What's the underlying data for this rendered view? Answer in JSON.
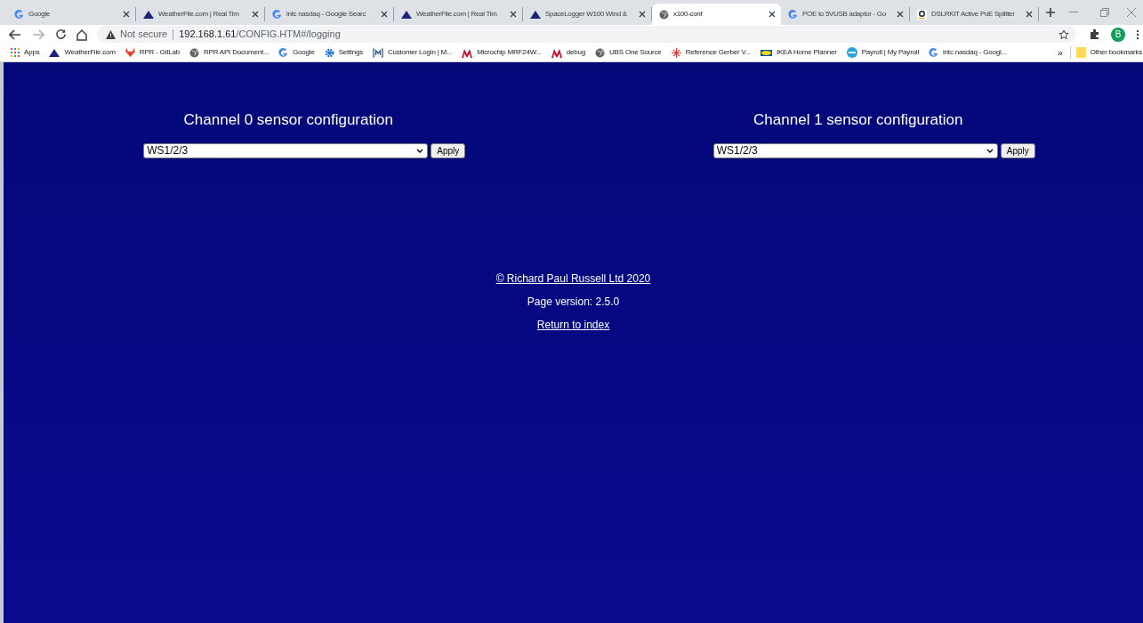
{
  "tabs": [
    {
      "title": "Google",
      "kind": "google",
      "selected": false
    },
    {
      "title": "WeatherFile.com | Real Tim",
      "kind": "triangle",
      "selected": false
    },
    {
      "title": "intc nasdaq - Google Searc",
      "kind": "google",
      "selected": false
    },
    {
      "title": "WeatherFile.com | Real Tim",
      "kind": "triangle",
      "selected": false
    },
    {
      "title": "SpaceLogger W100 Wind &",
      "kind": "triangle",
      "selected": false
    },
    {
      "title": "x100-conf",
      "kind": "globe",
      "selected": true
    },
    {
      "title": "POE to 5VUSB adaptor - Go",
      "kind": "google",
      "selected": false
    },
    {
      "title": "DSLRKIT Active PoE Splitter",
      "kind": "amazon",
      "selected": false
    }
  ],
  "address_bar": {
    "security": "Not secure",
    "host": "192.168.1.61",
    "path": "/CONFIG.HTM#/logging"
  },
  "profile": "B",
  "bookmarks": [
    {
      "label": "Apps",
      "kind": "apps"
    },
    {
      "label": "WeatherFile.com",
      "kind": "triangle"
    },
    {
      "label": "RPR - GitLab",
      "kind": "gitlab"
    },
    {
      "label": "RPR API Document...",
      "kind": "globe"
    },
    {
      "label": "Google",
      "kind": "google"
    },
    {
      "label": "Settings",
      "kind": "gear"
    },
    {
      "label": "Customer Login | M...",
      "kind": "m"
    },
    {
      "label": "Microchip MRF24W...",
      "kind": "chip"
    },
    {
      "label": "debug",
      "kind": "chip"
    },
    {
      "label": "UBS One Source",
      "kind": "globe"
    },
    {
      "label": "Reference Gerber V...",
      "kind": "burst"
    },
    {
      "label": "IKEA Home Planner",
      "kind": "ikea"
    },
    {
      "label": "Payroll | My Payroll",
      "kind": "payroll"
    },
    {
      "label": "intc nasdaq - Googl...",
      "kind": "google"
    }
  ],
  "overflow": "»",
  "other_bookmarks": "Other bookmarks",
  "channels": [
    {
      "heading": "Channel 0 sensor configuration",
      "sensor": "WS1/2/3",
      "button": "Apply"
    },
    {
      "heading": "Channel 1 sensor configuration",
      "sensor": "WS1/2/3",
      "button": "Apply"
    }
  ],
  "footer": {
    "copyright": "© Richard Paul Russell Ltd 2020",
    "version": "Page version: 2.5.0",
    "return_link": "Return to index"
  }
}
